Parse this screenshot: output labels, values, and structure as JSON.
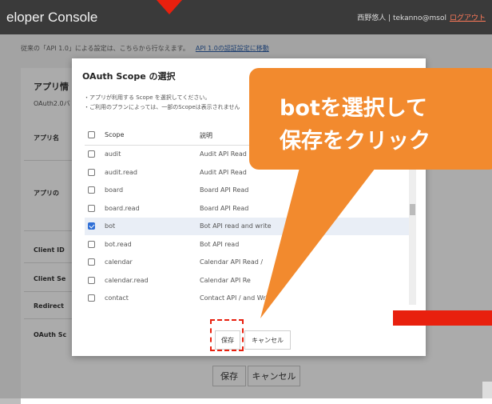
{
  "header": {
    "title": "eloper Console",
    "user": "西野悠人 | tekanno@msol",
    "logout": "ログアウト"
  },
  "notice": {
    "text": "従来の「API 1.0」による設定は、こちらから行なえます。",
    "link": "API 1.0の認証設定に移動"
  },
  "page": {
    "app_info_title": "アプリ情",
    "oauth_version": "OAuth2.0バ",
    "labels": [
      "アプリ名",
      "アプリの",
      "Client ID",
      "Client Se",
      "Redirect",
      "OAuth Sc"
    ],
    "save": "保存",
    "cancel": "キャンセル"
  },
  "modal": {
    "title": "OAuth Scope の選択",
    "note1": "・アプリが利用する Scope を選択してください。",
    "note2": "・ご利用のプランによっては、一部のScopeは表示されません",
    "col_scope": "Scope",
    "col_desc": "説明",
    "rows": [
      {
        "scope": "audit",
        "desc": "Audit API Read",
        "checked": false
      },
      {
        "scope": "audit.read",
        "desc": "Audit API Read",
        "checked": false
      },
      {
        "scope": "board",
        "desc": "Board API Read",
        "checked": false
      },
      {
        "scope": "board.read",
        "desc": "Board API Read",
        "checked": false
      },
      {
        "scope": "bot",
        "desc": "Bot API read and write",
        "checked": true
      },
      {
        "scope": "bot.read",
        "desc": "Bot API read",
        "checked": false
      },
      {
        "scope": "calendar",
        "desc": "Calendar API Read /",
        "checked": false
      },
      {
        "scope": "calendar.read",
        "desc": "Calendar API Re",
        "checked": false
      },
      {
        "scope": "contact",
        "desc": "Contact API / and Write",
        "checked": false
      }
    ],
    "save": "保存",
    "cancel": "キャンセル"
  },
  "callout": {
    "line1": "botを選択して",
    "line2": "保存をクリック"
  },
  "colors": {
    "accent_orange": "#f28a2e",
    "highlight_red": "#e8200e",
    "check_blue": "#2f6fd6"
  }
}
